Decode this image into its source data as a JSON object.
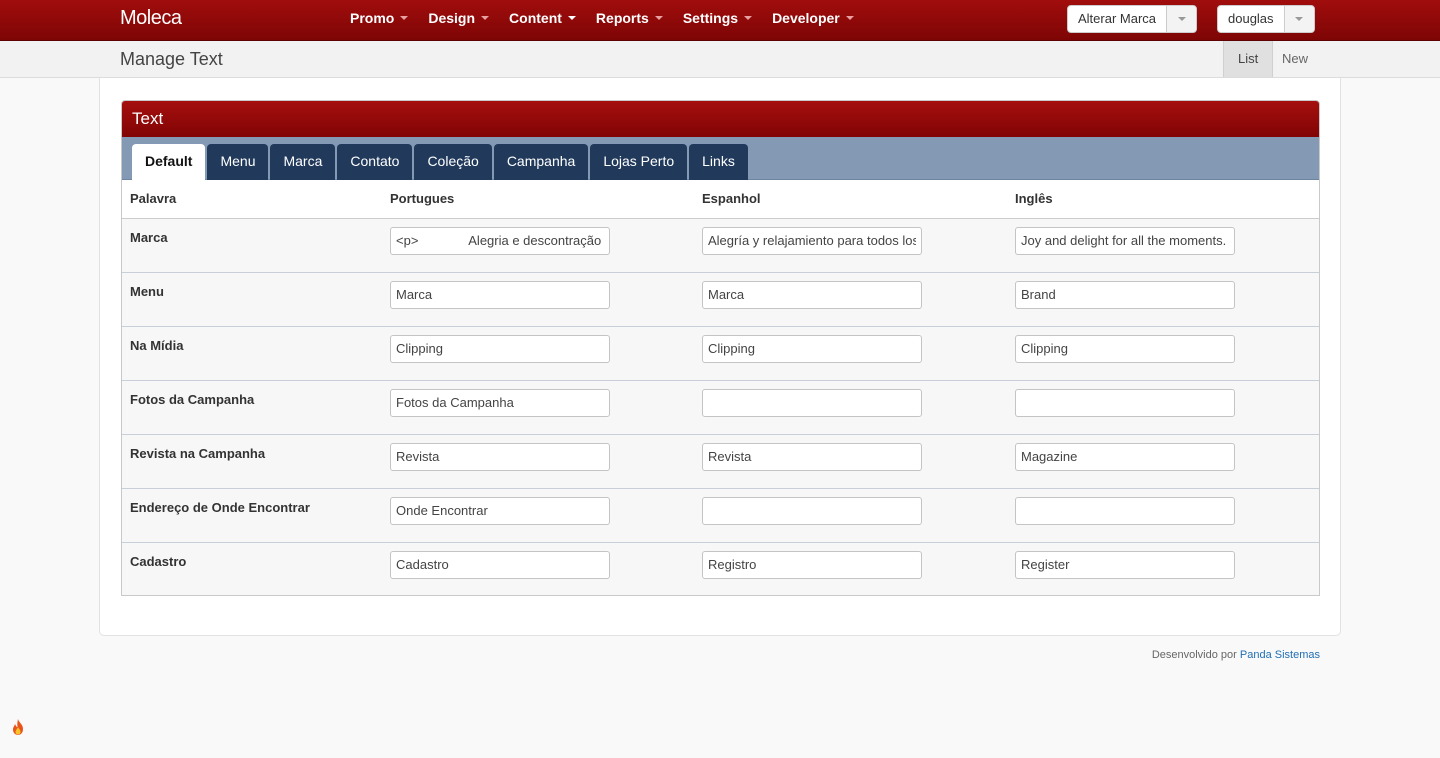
{
  "app": {
    "brand": "Moleca"
  },
  "nav": [
    {
      "label": "Promo"
    },
    {
      "label": "Design"
    },
    {
      "label": "Content"
    },
    {
      "label": "Reports"
    },
    {
      "label": "Settings"
    },
    {
      "label": "Developer"
    }
  ],
  "brand_switch": {
    "label": "Alterar Marca"
  },
  "user_menu": {
    "label": "douglas"
  },
  "page": {
    "title": "Manage Text",
    "actions": {
      "list": "List",
      "new": "New"
    }
  },
  "panel": {
    "title": "Text",
    "tabs": [
      "Default",
      "Menu",
      "Marca",
      "Contato",
      "Coleção",
      "Campanha",
      "Lojas Perto",
      "Links"
    ],
    "active_tab": "Default"
  },
  "table": {
    "headers": {
      "word": "Palavra",
      "pt": "Portugues",
      "es": "Espanhol",
      "en": "Inglês"
    },
    "rows": [
      {
        "word": "Marca",
        "pt": "<p>              Alegria e descontração para todos os momentos.",
        "es": "Alegría y relajamiento para todos los momentos.",
        "en": "Joy and delight for all the moments."
      },
      {
        "word": "Menu",
        "pt": "Marca",
        "es": "Marca",
        "en": "Brand"
      },
      {
        "word": "Na Mídia",
        "pt": "Clipping",
        "es": "Clipping",
        "en": "Clipping"
      },
      {
        "word": "Fotos da Campanha",
        "pt": "Fotos da Campanha",
        "es": "",
        "en": ""
      },
      {
        "word": "Revista na Campanha",
        "pt": "Revista",
        "es": "Revista",
        "en": "Magazine"
      },
      {
        "word": "Endereço de Onde Encontrar",
        "pt": "Onde Encontrar",
        "es": "",
        "en": ""
      },
      {
        "word": "Cadastro",
        "pt": "Cadastro",
        "es": "Registro",
        "en": "Register"
      }
    ]
  },
  "footer": {
    "prefix": "Desenvolvido por",
    "link": "Panda Sistemas"
  },
  "colors": {
    "nav_bg": "#9b0b0b",
    "tab_bg": "#213a5c",
    "tabs_strip": "#8399b4",
    "link": "#1f6fb5"
  }
}
